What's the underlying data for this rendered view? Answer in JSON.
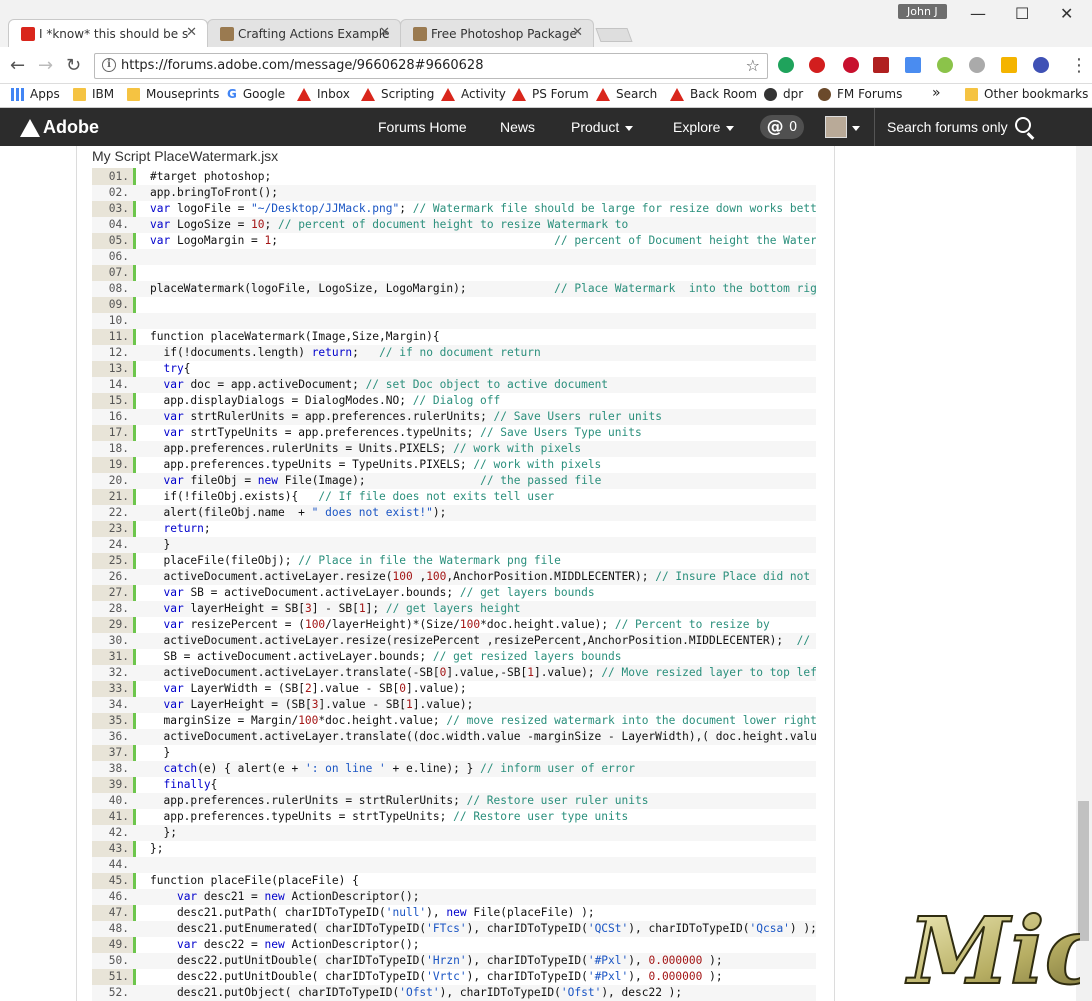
{
  "browser": {
    "tabs": [
      {
        "label": "I *know* this should be s",
        "active": true
      },
      {
        "label": "Crafting Actions Example",
        "active": false
      },
      {
        "label": "Free Photoshop Package",
        "active": false
      }
    ],
    "user_chip": "John J",
    "url": "https://forums.adobe.com/message/9660628#9660628"
  },
  "bookmarks": [
    {
      "label": "Apps",
      "icon": "apps-grid-icon"
    },
    {
      "label": "IBM",
      "icon": "folder-icon"
    },
    {
      "label": "Mouseprints",
      "icon": "folder-icon"
    },
    {
      "label": "Google",
      "icon": "google-icon"
    },
    {
      "label": "Inbox",
      "icon": "adobe-icon"
    },
    {
      "label": "Scripting",
      "icon": "adobe-icon"
    },
    {
      "label": "Activity",
      "icon": "adobe-icon"
    },
    {
      "label": "PS Forum",
      "icon": "adobe-icon"
    },
    {
      "label": "Search",
      "icon": "adobe-icon"
    },
    {
      "label": "Back Room",
      "icon": "adobe-icon"
    },
    {
      "label": "dpr",
      "icon": "dpr-icon"
    },
    {
      "label": "FM Forums",
      "icon": "fm-icon"
    }
  ],
  "other_bookmarks": "Other bookmarks",
  "overflow": "»",
  "adobe_nav": {
    "logo": "Adobe",
    "links": [
      "Forums Home",
      "News",
      "Product",
      "Explore"
    ],
    "at_symbol": "@",
    "notifications": "0",
    "search": "Search forums only"
  },
  "post": {
    "title": "My Script PlaceWatermark.jsx",
    "lines": [
      {
        "n": "01.",
        "code": "#target photoshop;"
      },
      {
        "n": "02.",
        "code": "app.bringToFront();"
      },
      {
        "n": "03.",
        "code": "var logoFile = \"~/Desktop/JJMack.png\"; // Watermark file should be large for resize down works better"
      },
      {
        "n": "04.",
        "code": "var LogoSize = 10; // percent of document height to resize Watermark to"
      },
      {
        "n": "05.",
        "code": "var LogoMargin = 1;                                         // percent of Document height the Waterma"
      },
      {
        "n": "06.",
        "code": ""
      },
      {
        "n": "07.",
        "code": ""
      },
      {
        "n": "08.",
        "code": "placeWatermark(logoFile, LogoSize, LogoMargin);             // Place Watermark  into the bottom right"
      },
      {
        "n": "09.",
        "code": ""
      },
      {
        "n": "10.",
        "code": ""
      },
      {
        "n": "11.",
        "code": "function placeWatermark(Image,Size,Margin){"
      },
      {
        "n": "12.",
        "code": "  if(!documents.length) return;   // if no document return"
      },
      {
        "n": "13.",
        "code": "  try{"
      },
      {
        "n": "14.",
        "code": "  var doc = app.activeDocument; // set Doc object to active document"
      },
      {
        "n": "15.",
        "code": "  app.displayDialogs = DialogModes.NO; // Dialog off"
      },
      {
        "n": "16.",
        "code": "  var strtRulerUnits = app.preferences.rulerUnits; // Save Users ruler units"
      },
      {
        "n": "17.",
        "code": "  var strtTypeUnits = app.preferences.typeUnits; // Save Users Type units"
      },
      {
        "n": "18.",
        "code": "  app.preferences.rulerUnits = Units.PIXELS; // work with pixels"
      },
      {
        "n": "19.",
        "code": "  app.preferences.typeUnits = TypeUnits.PIXELS; // work with pixels"
      },
      {
        "n": "20.",
        "code": "  var fileObj = new File(Image);                 // the passed file"
      },
      {
        "n": "21.",
        "code": "  if(!fileObj.exists){   // If file does not exits tell user"
      },
      {
        "n": "22.",
        "code": "  alert(fileObj.name  + \" does not exist!\");"
      },
      {
        "n": "23.",
        "code": "  return;"
      },
      {
        "n": "24.",
        "code": "  }"
      },
      {
        "n": "25.",
        "code": "  placeFile(fileObj); // Place in file the Watermark png file"
      },
      {
        "n": "26.",
        "code": "  activeDocument.activeLayer.resize(100 ,100,AnchorPosition.MIDDLECENTER); // Insure Place did not sc"
      },
      {
        "n": "27.",
        "code": "  var SB = activeDocument.activeLayer.bounds; // get layers bounds"
      },
      {
        "n": "28.",
        "code": "  var layerHeight = SB[3] - SB[1]; // get layers height"
      },
      {
        "n": "29.",
        "code": "  var resizePercent = (100/layerHeight)*(Size/100*doc.height.value); // Percent to resize by"
      },
      {
        "n": "30.",
        "code": "  activeDocument.activeLayer.resize(resizePercent ,resizePercent,AnchorPosition.MIDDLECENTER);  // Re"
      },
      {
        "n": "31.",
        "code": "  SB = activeDocument.activeLayer.bounds; // get resized layers bounds"
      },
      {
        "n": "32.",
        "code": "  activeDocument.activeLayer.translate(-SB[0].value,-SB[1].value); // Move resized layer to top left"
      },
      {
        "n": "33.",
        "code": "  var LayerWidth = (SB[2].value - SB[0].value);"
      },
      {
        "n": "34.",
        "code": "  var LayerHeight = (SB[3].value - SB[1].value);"
      },
      {
        "n": "35.",
        "code": "  marginSize = Margin/100*doc.height.value; // move resized watermark into the document lower right c"
      },
      {
        "n": "36.",
        "code": "  activeDocument.activeLayer.translate((doc.width.value -marginSize - LayerWidth),( doc.height.value"
      },
      {
        "n": "37.",
        "code": "  }"
      },
      {
        "n": "38.",
        "code": "  catch(e) { alert(e + ': on line ' + e.line); } // inform user of error"
      },
      {
        "n": "39.",
        "code": "  finally{"
      },
      {
        "n": "40.",
        "code": "  app.preferences.rulerUnits = strtRulerUnits; // Restore user ruler units"
      },
      {
        "n": "41.",
        "code": "  app.preferences.typeUnits = strtTypeUnits; // Restore user type units"
      },
      {
        "n": "42.",
        "code": "  };"
      },
      {
        "n": "43.",
        "code": "};"
      },
      {
        "n": "44.",
        "code": ""
      },
      {
        "n": "45.",
        "code": "function placeFile(placeFile) {"
      },
      {
        "n": "46.",
        "code": "    var desc21 = new ActionDescriptor();"
      },
      {
        "n": "47.",
        "code": "    desc21.putPath( charIDToTypeID('null'), new File(placeFile) );"
      },
      {
        "n": "48.",
        "code": "    desc21.putEnumerated( charIDToTypeID('FTcs'), charIDToTypeID('QCSt'), charIDToTypeID('Qcsa') );"
      },
      {
        "n": "49.",
        "code": "    var desc22 = new ActionDescriptor();"
      },
      {
        "n": "50.",
        "code": "    desc22.putUnitDouble( charIDToTypeID('Hrzn'), charIDToTypeID('#Pxl'), 0.000000 );"
      },
      {
        "n": "51.",
        "code": "    desc22.putUnitDouble( charIDToTypeID('Vrtc'), charIDToTypeID('#Pxl'), 0.000000 );"
      },
      {
        "n": "52.",
        "code": "    desc21.putObject( charIDToTypeID('Ofst'), charIDToTypeID('Ofst'), desc22 );"
      }
    ]
  },
  "watermark": "Mick",
  "colors": {
    "adobe_bar": "#2c2c2c",
    "gutter": "#e8e4d8",
    "gutter_accent": "#6dc64c",
    "keyword": "#0000cc",
    "comment": "#2a8f7c",
    "string": "#1a55c4"
  }
}
